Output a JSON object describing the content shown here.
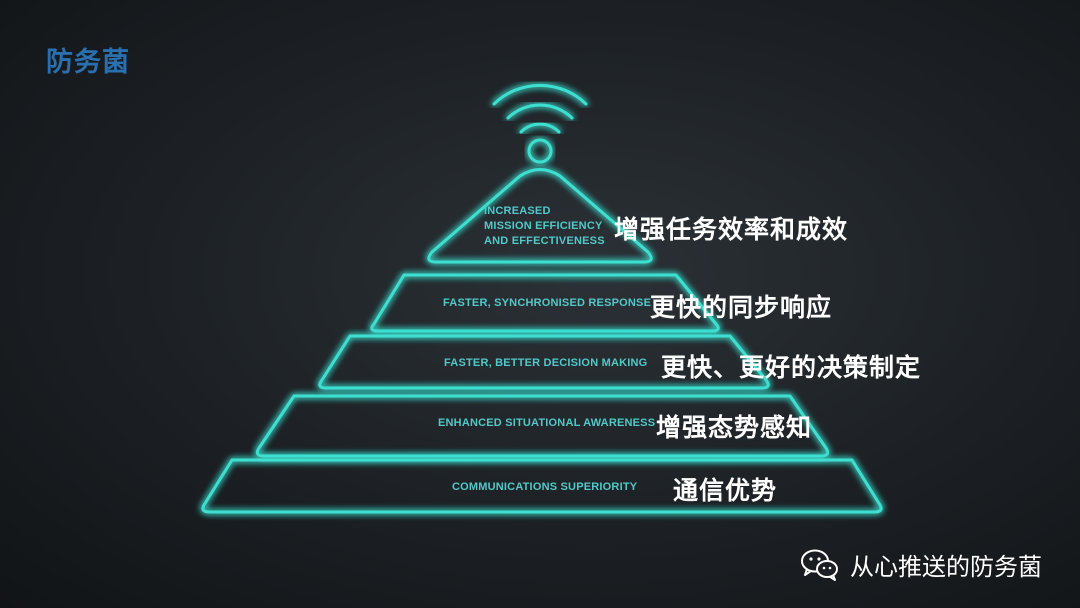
{
  "brand": {
    "name": "防务菌"
  },
  "pyramid": {
    "tiers": [
      {
        "en": "INCREASED\nMISSION EFFICIENCY\nAND EFFECTIVENESS",
        "zh": "增强任务效率和成效"
      },
      {
        "en": "FASTER, SYNCHRONISED RESPONSE",
        "zh": "更快的同步响应"
      },
      {
        "en": "FASTER, BETTER DECISION MAKING",
        "zh": "更快、更好的决策制定"
      },
      {
        "en": "ENHANCED SITUATIONAL AWARENESS",
        "zh": "增强态势感知"
      },
      {
        "en": "COMMUNICATIONS SUPERIORITY",
        "zh": "通信优势"
      }
    ],
    "top_icon": "wifi-signal-icon",
    "accent_color": "#3ee0d0"
  },
  "footer": {
    "icon": "wechat-icon",
    "text": "从心推送的防务菌"
  }
}
